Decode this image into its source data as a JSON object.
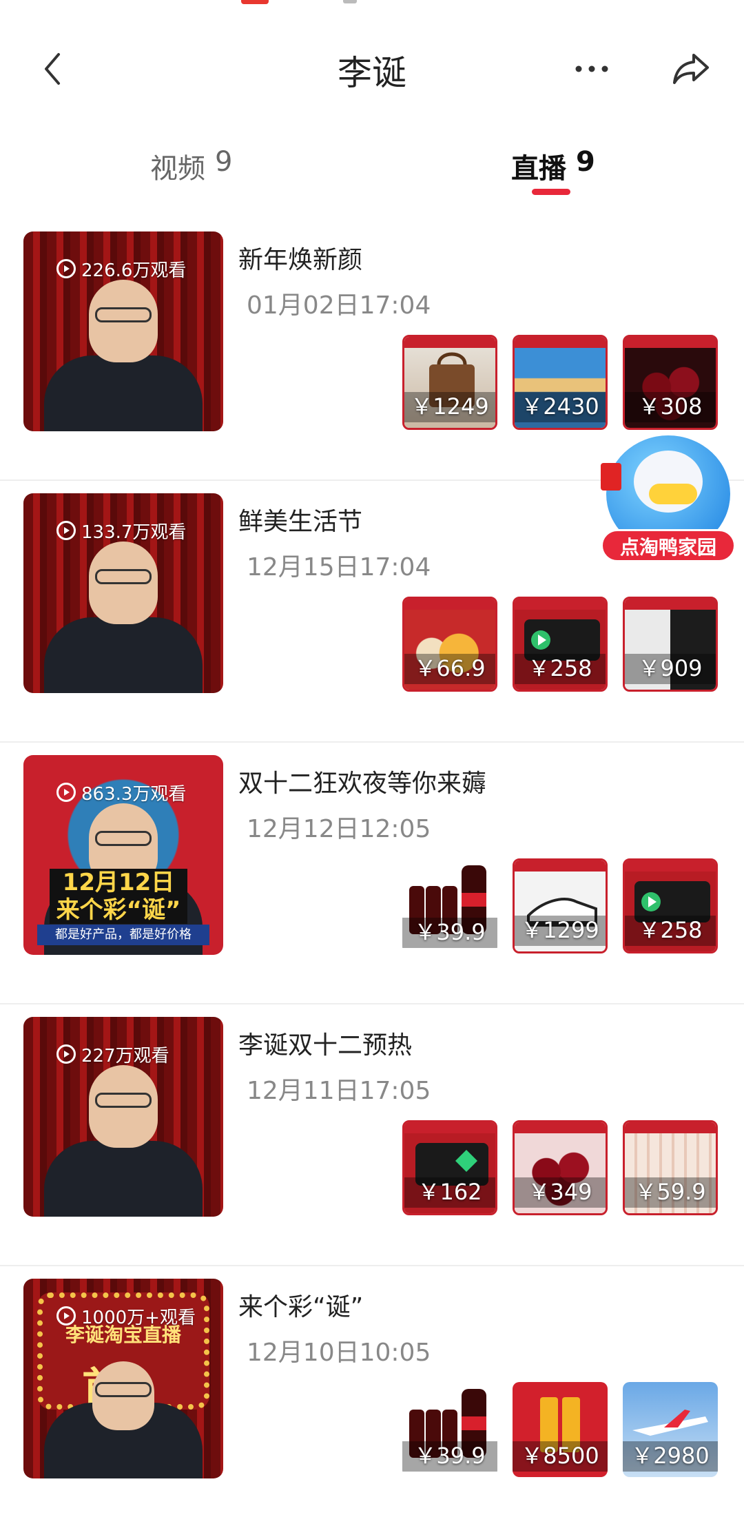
{
  "header": {
    "title": "李诞"
  },
  "tabs": [
    {
      "label": "视频",
      "count": "9",
      "active": false
    },
    {
      "label": "直播",
      "count": "9",
      "active": true
    }
  ],
  "colors": {
    "accent": "#e8283a",
    "text_primary": "#222222",
    "text_secondary": "#888888",
    "divider": "#eeeeee"
  },
  "floating_badge": {
    "label": "点淘鸭家园",
    "icon": "duck-mascot-icon"
  },
  "lives": [
    {
      "views": "226.6万观看",
      "title": "新年焕新颜",
      "date": "01月02日17:04",
      "products": [
        {
          "price": "￥1249",
          "icon": "handbag-icon"
        },
        {
          "price": "￥2430",
          "icon": "landscape-icon"
        },
        {
          "price": "￥308",
          "icon": "cherry-icon"
        }
      ]
    },
    {
      "views": "133.7万观看",
      "title": "鲜美生活节",
      "date": "12月15日17:04",
      "products": [
        {
          "price": "￥66.9",
          "icon": "fruit-drink-icon"
        },
        {
          "price": "￥258",
          "icon": "video-vip-icon"
        },
        {
          "price": "￥909",
          "icon": "down-jacket-icon"
        }
      ]
    },
    {
      "views": "863.3万观看",
      "title": "双十二狂欢夜等你来薅",
      "date": "12月12日12:05",
      "thumb_text": {
        "main": "12月12日 来个彩“诞”",
        "sub": "都是好产品，都是好价格"
      },
      "products": [
        {
          "price": "￥39.9",
          "icon": "cola-bottles-icon"
        },
        {
          "price": "￥1299",
          "icon": "sneaker-icon"
        },
        {
          "price": "￥258",
          "icon": "video-vip-icon"
        }
      ]
    },
    {
      "views": "227万观看",
      "title": "李诞双十二预热",
      "date": "12月11日17:05",
      "products": [
        {
          "price": "￥162",
          "icon": "membership-card-icon"
        },
        {
          "price": "￥349",
          "icon": "cherry-icon"
        },
        {
          "price": "￥59.9",
          "icon": "tissue-pack-icon"
        }
      ]
    },
    {
      "views": "1000万+观看",
      "title": "来个彩“诞”",
      "date": "12月10日10:05",
      "thumb_text": {
        "top": "李诞淘宝直播",
        "big": "首秀"
      },
      "products": [
        {
          "price": "￥39.9",
          "icon": "cola-bottles-icon"
        },
        {
          "price": "￥8500",
          "icon": "gold-bar-icon"
        },
        {
          "price": "￥2980",
          "icon": "airplane-icon"
        }
      ]
    }
  ]
}
